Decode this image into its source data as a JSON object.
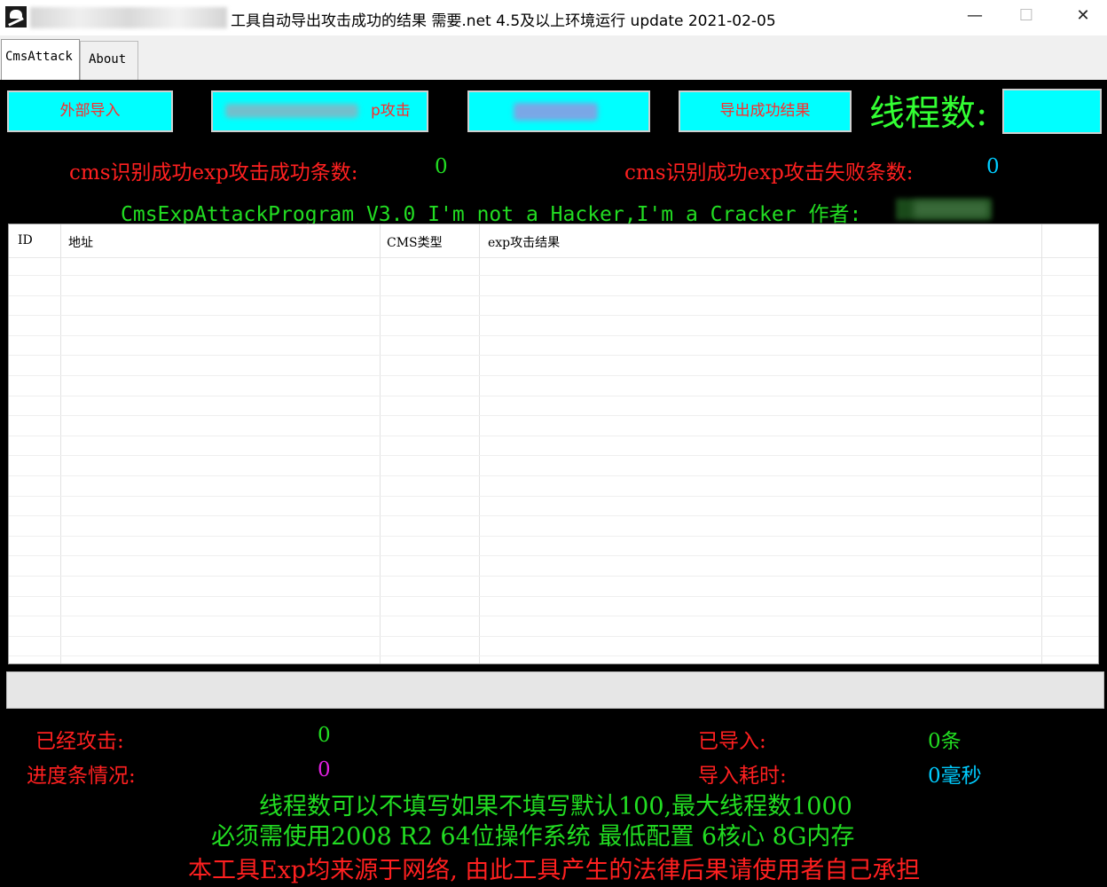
{
  "window": {
    "title": "工具自动导出攻击成功的结果  需要.net 4.5及以上环境运行 update 2021-02-05",
    "minimize_glyph": "—",
    "maximize_glyph": "☐",
    "close_glyph": "✕"
  },
  "tabs": [
    {
      "label": "CmsAttack",
      "selected": true
    },
    {
      "label": "About",
      "selected": false
    }
  ],
  "toolbar": {
    "import_label": "外部导入",
    "exp_attack_label_visible": "p攻击",
    "export_label": "导出成功结果",
    "thread_label": "线程数:",
    "thread_value": ""
  },
  "stats_top": {
    "success_label": "cms识别成功exp攻击成功条数:",
    "success_value": "0",
    "fail_label": "cms识别成功exp攻击失败条数:",
    "fail_value": "0"
  },
  "banner": "CmsExpAttackProgram V3.0 I'm not a Hacker,I'm a Cracker 作者:",
  "table": {
    "columns": [
      "ID",
      "地址",
      "CMS类型",
      "exp攻击结果"
    ],
    "rows": []
  },
  "stats_bottom": {
    "attacked_label": "已经攻击:",
    "attacked_value": "0",
    "imported_label": "已导入:",
    "imported_value": "0条",
    "progress_label": "进度条情况:",
    "progress_value": "0",
    "import_time_label": "导入耗时:",
    "import_time_value": "0毫秒"
  },
  "notes": {
    "line1": "线程数可以不填写如果不填写默认100,最大线程数1000",
    "line2": "必须需使用2008 R2 64位操作系统 最低配置 6核心 8G内存",
    "line3": "本工具Exp均来源于网络, 由此工具产生的法律后果请使用者自己承担"
  },
  "progress": {
    "fraction": 0
  },
  "colors": {
    "panel_bg": "#000000",
    "button_bg": "#00ffff",
    "red_text": "#ff2020",
    "green_text": "#22dd22",
    "cyan_text": "#00ccff",
    "magenta_text": "#e020e0"
  }
}
